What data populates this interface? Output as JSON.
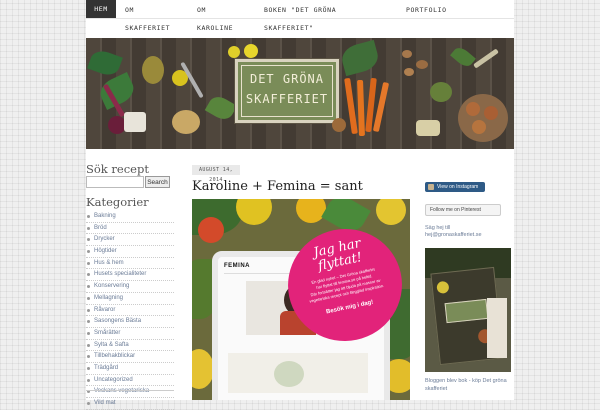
{
  "nav": {
    "items": [
      {
        "label": "HEM"
      },
      {
        "label": "OM"
      },
      {
        "label": "SKAFFERIET"
      },
      {
        "label": "OM"
      },
      {
        "label": "KAROLINE"
      },
      {
        "label": "BOKEN \"DET GRÖNA"
      },
      {
        "label": "SKAFFERIET\""
      },
      {
        "label": "PORTFOLIO"
      }
    ]
  },
  "header": {
    "sign_line1": "DET GRÖNA",
    "sign_line2": "SKAFFERIET"
  },
  "sidebar": {
    "search_heading": "Sök recept",
    "search_value": "",
    "search_button": "Search",
    "categories_heading": "Kategorier",
    "categories": [
      "Bakning",
      "Bröd",
      "Drycker",
      "Högtider",
      "Hus & hem",
      "Husets specialiteter",
      "Konservering",
      "Mellagning",
      "Råvaror",
      "Sasongens Bästa",
      "Smårätter",
      "Sylta & Safta",
      "Tillbehakblickar",
      "Trädgård",
      "Uncategorized",
      "Veckans vegetariska",
      "Vild mat"
    ]
  },
  "post": {
    "date": "AUGUST 14, 2014",
    "title": "Karoline + Femina = sant",
    "image": {
      "magazine_name": "FEMINA",
      "bubble_title_line1": "Jag har",
      "bubble_title_line2": "flyttat!",
      "bubble_lines": [
        "En glad nyhet – Det Gröna skafferiet",
        "har flyttat till femina.se på heltid.",
        "Där fortsätter jag att bjuda på massor av",
        "vegetariska recept och färgglad inspiration."
      ],
      "bubble_cta": "Besök mig i dag!"
    }
  },
  "right_sidebar": {
    "instagram_label": "View on Instagram",
    "pinterest_label": "Follow me on Pinterest",
    "say_hi_line1": "Säg hej till",
    "say_hi_line2": "hej@gronaskafferiet.se",
    "book_caption": "Bloggen blev bok - köp Det gröna skafferiet"
  },
  "colors": {
    "accent_pink": "#e2237a",
    "nav_active_bg": "#333333",
    "link_color": "#6a7b96",
    "sign_green": "#7a8c58"
  }
}
